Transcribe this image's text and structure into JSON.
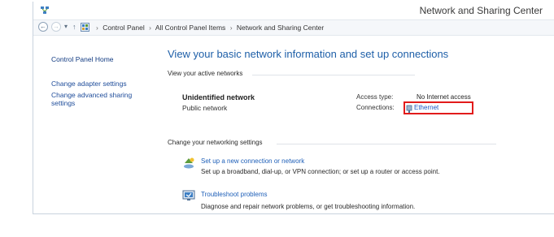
{
  "window": {
    "title": "Network and Sharing Center",
    "app_icon": "network-sharing-icon"
  },
  "address_bar": {
    "breadcrumb": [
      "Control Panel",
      "All Control Panel Items",
      "Network and Sharing Center"
    ],
    "separator": "›"
  },
  "sidebar": {
    "home_label": "Control Panel Home",
    "links": [
      "Change adapter settings",
      "Change advanced sharing settings"
    ]
  },
  "main": {
    "title": "View your basic network information and set up connections",
    "active_networks_heading": "View your active networks",
    "network": {
      "name": "Unidentified network",
      "type": "Public network",
      "access_type_label": "Access type:",
      "access_type_value": "No Internet access",
      "connections_label": "Connections:",
      "connection_name": "Ethernet",
      "highlight_color": "#e21b1b"
    },
    "settings_heading": "Change your networking settings",
    "tasks": [
      {
        "icon": "new-connection-icon",
        "link": "Set up a new connection or network",
        "description": "Set up a broadband, dial-up, or VPN connection; or set up a router or access point."
      },
      {
        "icon": "troubleshoot-icon",
        "link": "Troubleshoot problems",
        "description": "Diagnose and repair network problems, or get troubleshooting information."
      }
    ]
  },
  "colors": {
    "link": "#1e5fb8",
    "title": "#1e5fa8",
    "highlight": "#e21b1b"
  }
}
